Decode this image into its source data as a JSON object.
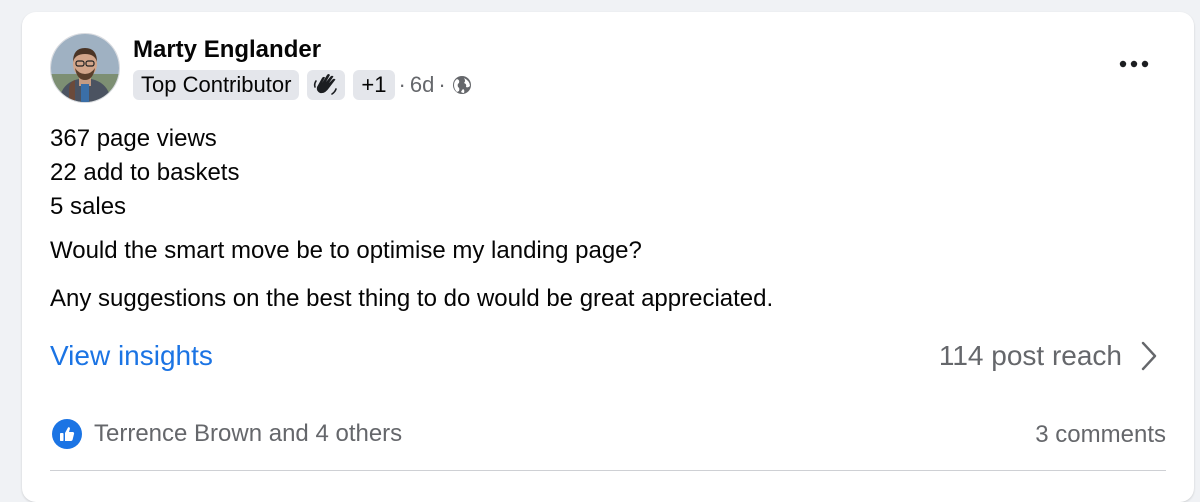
{
  "post": {
    "author": {
      "name": "Marty Englander",
      "badge": "Top Contributor",
      "badge_icon": "waving-hand-icon",
      "extra_badges": "+1",
      "time": "6d",
      "separator": "·",
      "audience_icon": "globe-icon"
    },
    "menu_icon": "more-options-icon",
    "body": {
      "lines": [
        "367 page views",
        "22 add to baskets",
        "5 sales"
      ],
      "question": "Would the smart move be to optimise my landing page?",
      "request": "Any suggestions on the best thing to do would be great appreciated."
    },
    "insights": {
      "link_label": "View insights",
      "reach_label": "114 post reach"
    },
    "footer": {
      "reactions_text": "Terrence Brown and 4 others",
      "reaction_icon": "like-icon",
      "comments_text": "3 comments"
    }
  },
  "colors": {
    "link": "#1b74e4",
    "secondary_text": "#65676b",
    "chip_bg": "#e4e6eb",
    "page_bg": "#f0f2f5"
  }
}
